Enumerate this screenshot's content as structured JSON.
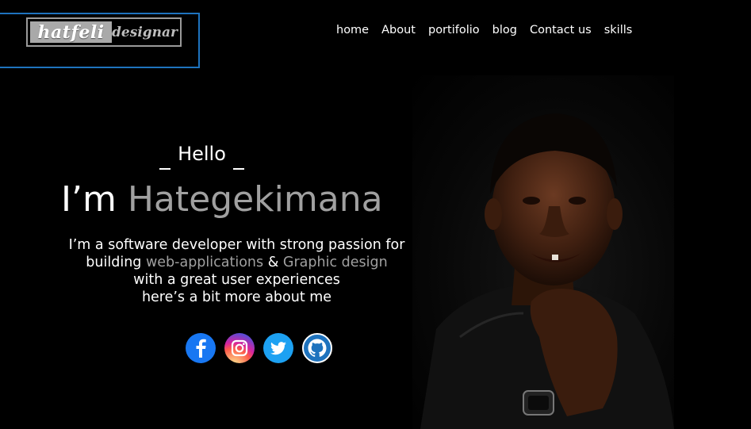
{
  "logo": {
    "left_text": "hatfeli",
    "right_text": "designar"
  },
  "nav": {
    "items": [
      "home",
      "About",
      "portifolio",
      "blog",
      "Contact us",
      "skills"
    ]
  },
  "hero": {
    "hello": "Hello",
    "im_prefix": "I’m ",
    "name": "Hategekimana",
    "line1": "I’m a software developer with strong passion for",
    "line2_prefix": "building ",
    "highlight1": "web-applications",
    "amp": " & ",
    "highlight2": "Graphic design",
    "line3": "with a great user experiences",
    "line4": "here’s a bit more about me"
  },
  "socials": [
    "facebook-icon",
    "instagram-icon",
    "twitter-icon",
    "github-icon"
  ],
  "colors": {
    "accent": "#1e73be",
    "highlight": "#a0a0a0",
    "background": "#000000",
    "facebook": "#1877f2",
    "twitter": "#1da1f2",
    "github": "#1e73be"
  }
}
